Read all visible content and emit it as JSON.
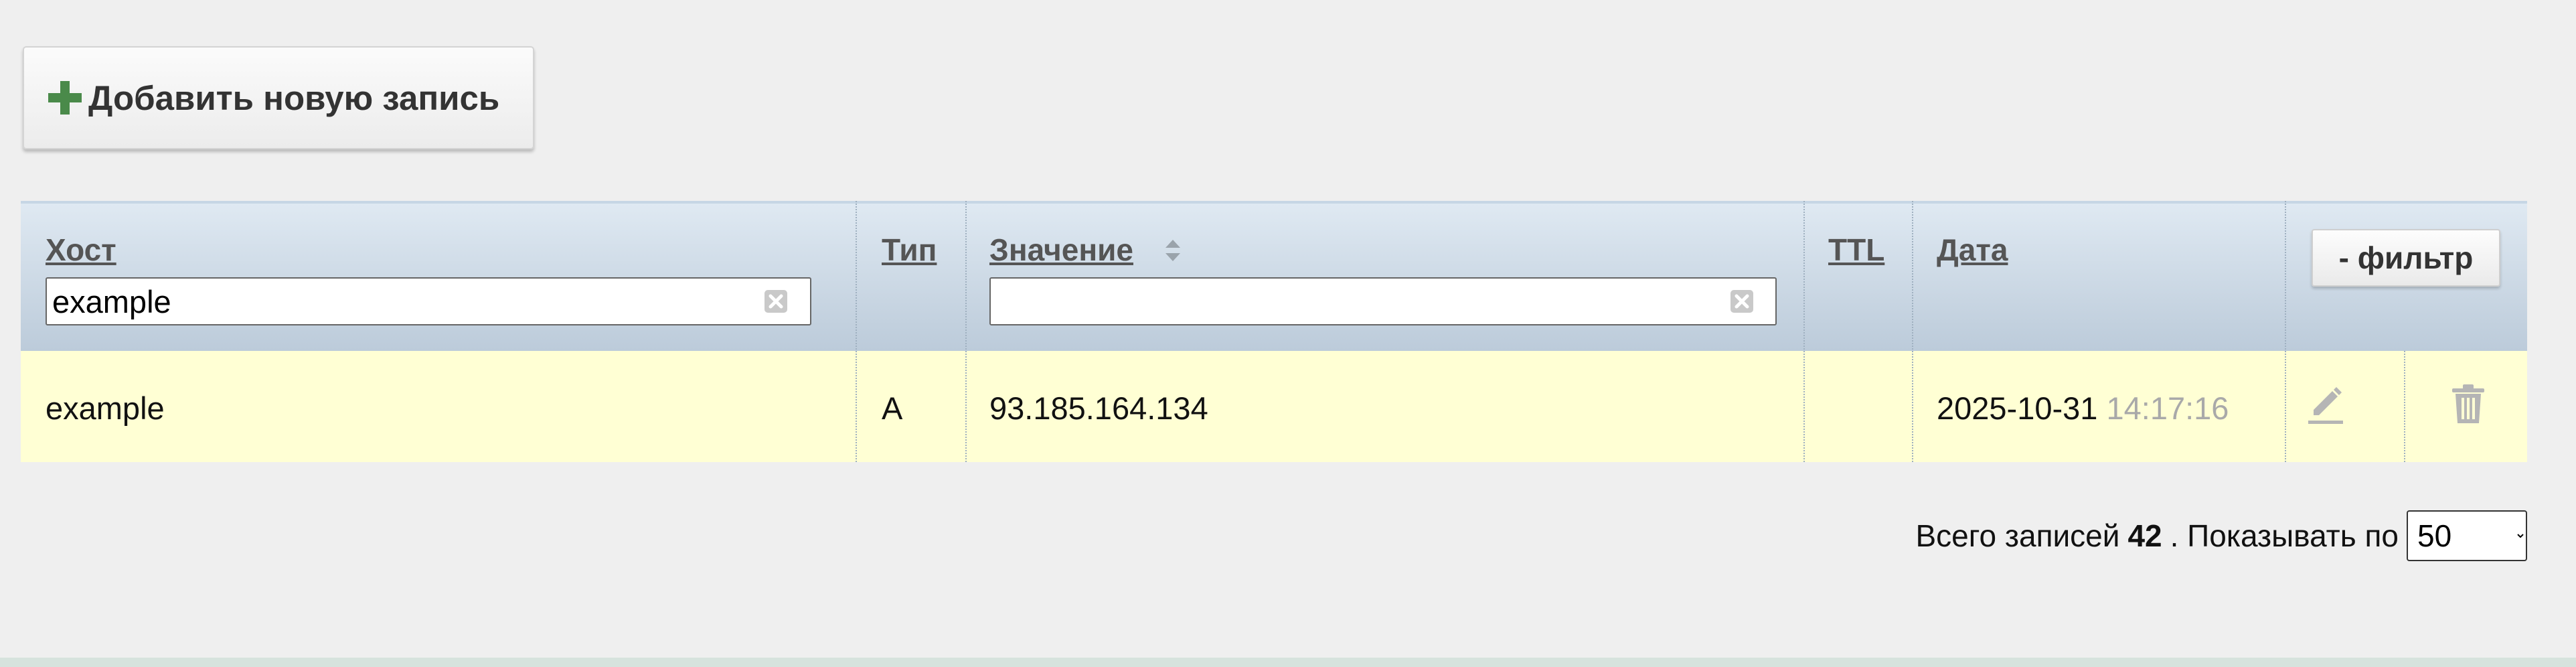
{
  "toolbar": {
    "add_label": "Добавить новую запись",
    "add_icon": "plus-icon",
    "add_icon_color": "#4a8a4a"
  },
  "table": {
    "columns": {
      "host": "Хост",
      "type": "Тип",
      "value": "Значение",
      "ttl": "TTL",
      "date": "Дата"
    },
    "filters": {
      "host_value": "example",
      "value_value": ""
    },
    "filter_button_label": "- фильтр",
    "rows": [
      {
        "host": "example",
        "type": "A",
        "value": "93.185.164.134",
        "ttl": "",
        "date": "2025-10-31",
        "time": "14:17:16",
        "edit_icon": "pencil-icon",
        "delete_icon": "trash-icon"
      }
    ]
  },
  "pagination": {
    "total_label": "Всего записей",
    "total_count": "42",
    "per_page_label": ". Показывать по",
    "per_page_value": "50",
    "per_page_options": [
      "50"
    ]
  },
  "colors": {
    "row_highlight": "#ffffd4",
    "header_top": "#dfe9f2",
    "header_bottom": "#bccbda",
    "page_background": "#efefef"
  }
}
